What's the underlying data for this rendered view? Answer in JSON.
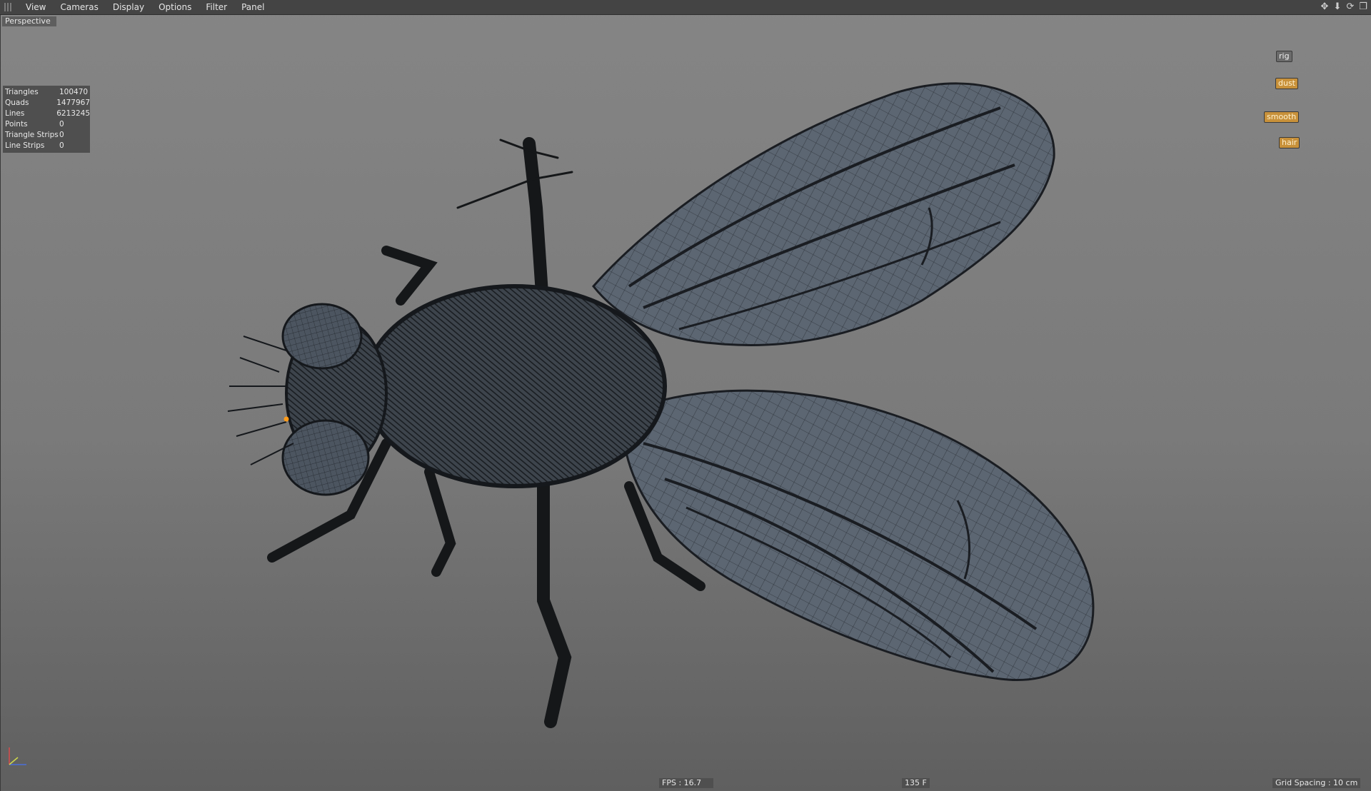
{
  "menubar": {
    "items": [
      "View",
      "Cameras",
      "Display",
      "Options",
      "Filter",
      "Panel"
    ]
  },
  "viewport": {
    "camera_label": "Perspective",
    "stats": [
      {
        "name": "Triangles",
        "value": "100470"
      },
      {
        "name": "Quads",
        "value": "1477967"
      },
      {
        "name": "Lines",
        "value": "6213245"
      },
      {
        "name": "Points",
        "value": "0"
      },
      {
        "name": "Triangle Strips",
        "value": "0"
      },
      {
        "name": "Line Strips",
        "value": "0"
      }
    ],
    "layers": {
      "rig": "rig",
      "dust": "dust",
      "smooth": "smooth",
      "hair": "hair"
    },
    "hud": {
      "fps": "FPS : 16.7",
      "frame": "135 F",
      "grid_spacing": "Grid Spacing : 10 cm"
    }
  },
  "colors": {
    "background_top": "#858585",
    "background_bottom": "#5f5f5f",
    "mesh_fill": "#5c6672",
    "wire": "#1a1d22",
    "layer_active": "#c8913a"
  }
}
